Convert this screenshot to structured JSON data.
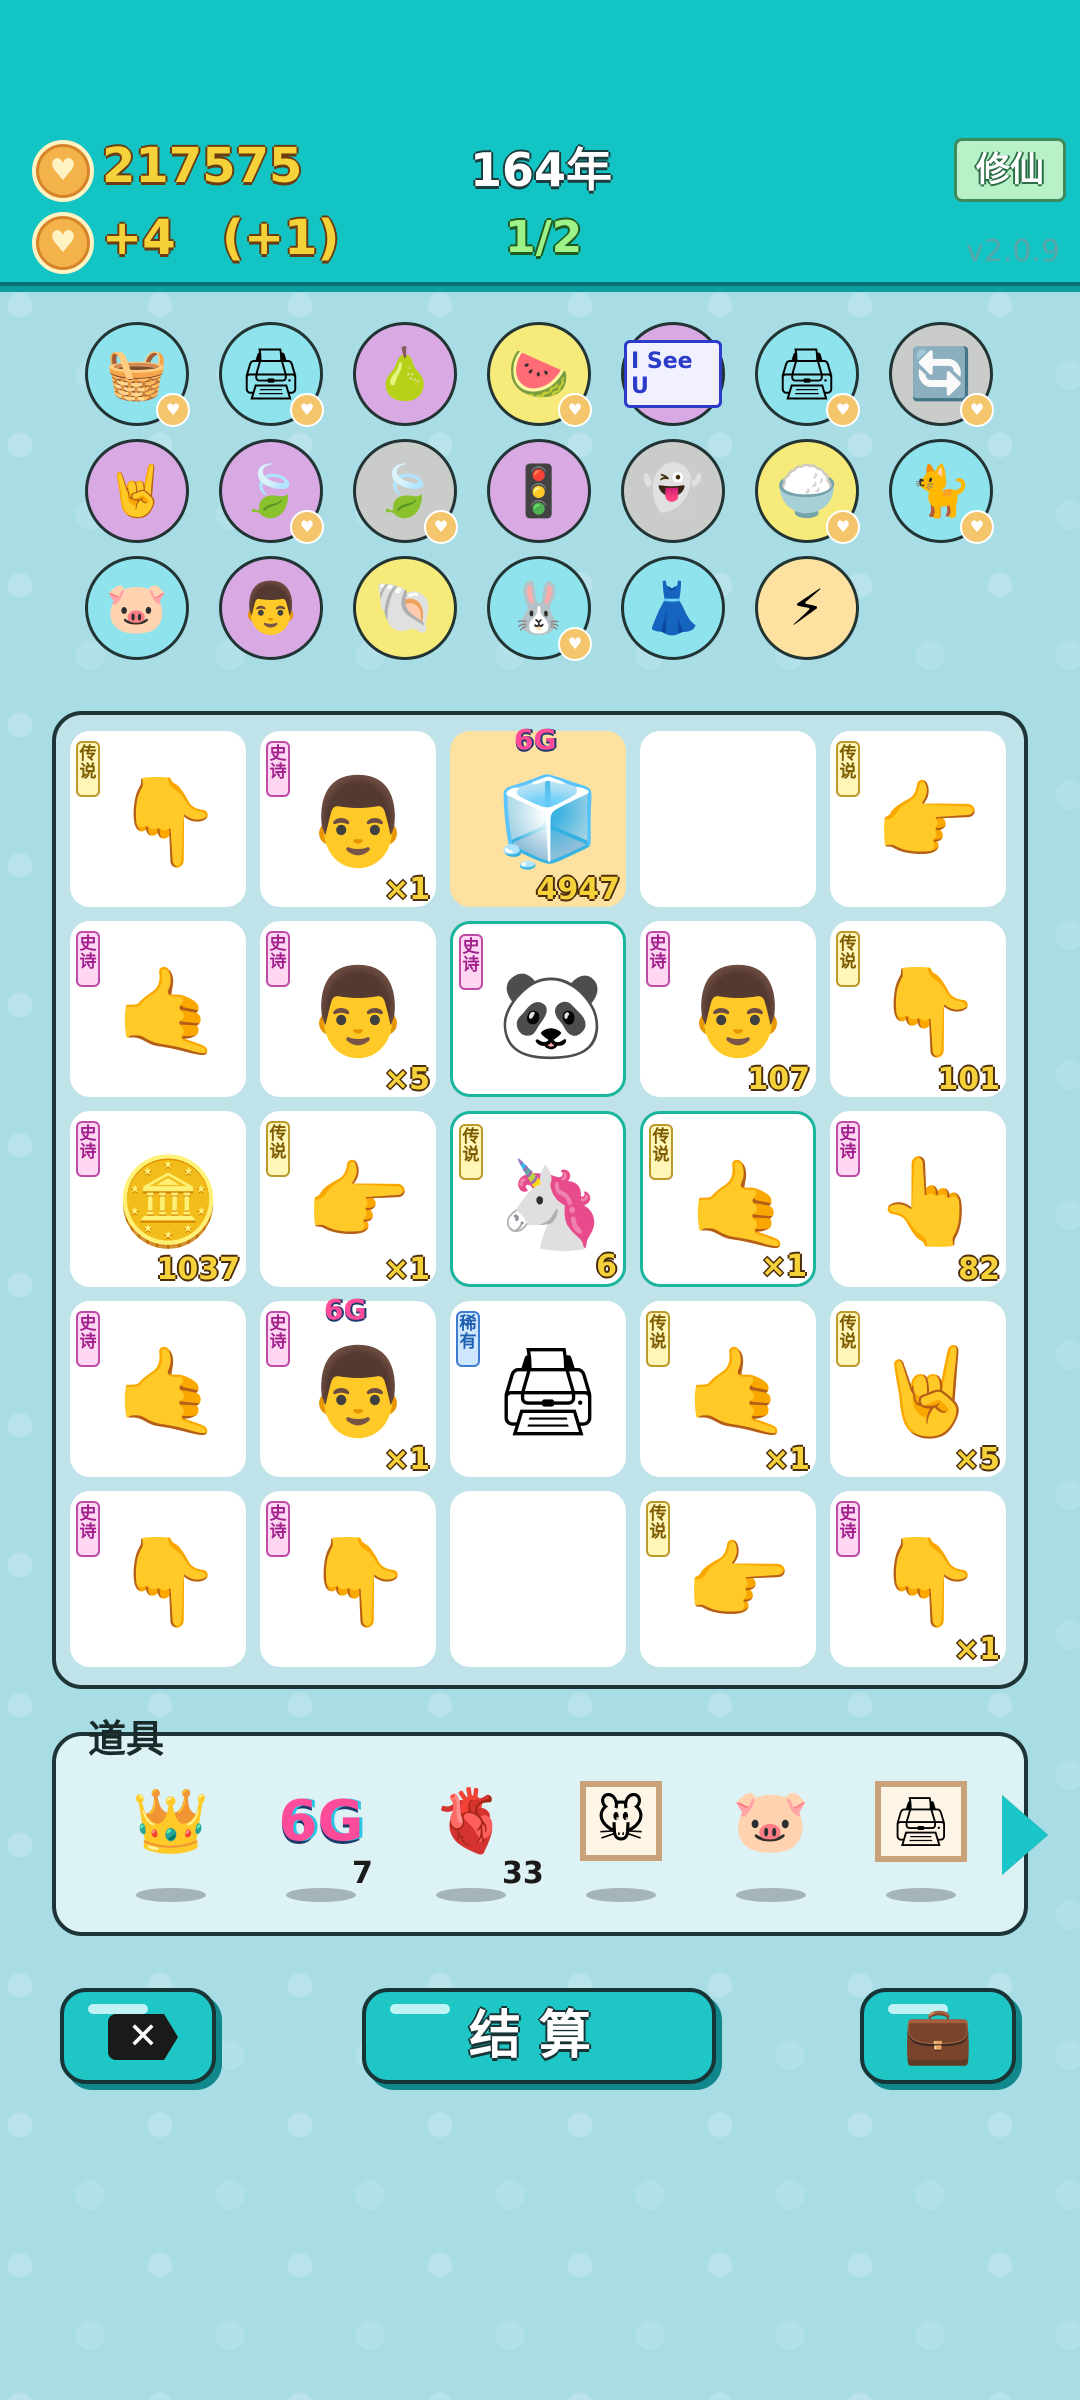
{
  "header": {
    "coins": "217575",
    "income": "+4",
    "bonus": "(+1)",
    "year": "164年",
    "round": "1/2",
    "mode_button": "修仙",
    "version": "v2.0.9"
  },
  "relics": [
    {
      "icon": "fruit-basket-icon",
      "glyph": "🧺",
      "bg": "#8fe3ec",
      "badge": true
    },
    {
      "icon": "printer-icon",
      "glyph": "🖨",
      "bg": "#8fe3ec",
      "badge": true
    },
    {
      "icon": "pomelo-icon",
      "glyph": "🍐",
      "bg": "#d8a9e3",
      "badge": false
    },
    {
      "icon": "fruit-plate-icon",
      "glyph": "🍉",
      "bg": "#f5ea7a",
      "badge": true
    },
    {
      "icon": "i-see-u-icon",
      "glyph": "I See U",
      "bg": "#d8a9e3",
      "badge": false
    },
    {
      "icon": "printer-icon",
      "glyph": "🖨",
      "bg": "#8fe3ec",
      "badge": true
    },
    {
      "icon": "refresh-icon",
      "glyph": "🔄",
      "bg": "#c9ccc9",
      "badge": true
    },
    {
      "icon": "rock-hand-icon",
      "glyph": "🤘",
      "bg": "#d8a9e3",
      "badge": false
    },
    {
      "icon": "leaf-icon",
      "glyph": "🍃",
      "bg": "#d8a9e3",
      "badge": true
    },
    {
      "icon": "leaf-icon",
      "glyph": "🍃",
      "bg": "#c9ccc9",
      "badge": true
    },
    {
      "icon": "traffic-light-ghost-icon",
      "glyph": "🚦",
      "bg": "#d8a9e3",
      "badge": false
    },
    {
      "icon": "ghost-icon",
      "glyph": "👻",
      "bg": "#c9ccc9",
      "badge": false
    },
    {
      "icon": "rice-bowl-icon",
      "glyph": "🍚",
      "bg": "#f5ea7a",
      "badge": true
    },
    {
      "icon": "cat-icon",
      "glyph": "🐈",
      "bg": "#8fe3ec",
      "badge": true
    },
    {
      "icon": "piggy-bank-icon",
      "glyph": "🐷",
      "bg": "#8fe3ec",
      "badge": false
    },
    {
      "icon": "multiplier-man-icon",
      "glyph": "👨",
      "bg": "#d8a9e3",
      "badge": false
    },
    {
      "icon": "shell-icon",
      "glyph": "🐚",
      "bg": "#f5ea7a",
      "badge": false
    },
    {
      "icon": "rabbit-icon",
      "glyph": "🐰",
      "bg": "#8fe3ec",
      "badge": true
    },
    {
      "icon": "skirt-icon",
      "glyph": "👗",
      "bg": "#8fe3ec",
      "badge": false
    },
    {
      "icon": "lightning-icon",
      "glyph": "⚡",
      "bg": "#fde1a0",
      "badge": false
    }
  ],
  "board": [
    [
      {
        "name": "legend-hand-cell",
        "tag": "传说",
        "tagType": "leg",
        "glyph": "👇",
        "count": ""
      },
      {
        "name": "epic-man-cell",
        "tag": "史诗",
        "tagType": "epic",
        "glyph": "👨",
        "count": "×1"
      },
      {
        "name": "fridge-cell",
        "tag": "",
        "tagType": "",
        "glyph": "🧊",
        "count": "4947",
        "gold": true,
        "top": "6G"
      },
      {
        "name": "empty-cell",
        "tag": "",
        "tagType": "",
        "glyph": "",
        "count": ""
      },
      {
        "name": "legend-hand-cell",
        "tag": "传说",
        "tagType": "leg",
        "glyph": "👉",
        "count": ""
      }
    ],
    [
      {
        "name": "epic-hand-cell",
        "tag": "史诗",
        "tagType": "epic",
        "glyph": "🤙",
        "count": ""
      },
      {
        "name": "epic-man-cell",
        "tag": "史诗",
        "tagType": "epic",
        "glyph": "👨",
        "count": "×5"
      },
      {
        "name": "panda-cell",
        "tag": "史诗",
        "tagType": "epic",
        "glyph": "🐼",
        "count": "",
        "hl": true
      },
      {
        "name": "epic-man-cell",
        "tag": "史诗",
        "tagType": "epic",
        "glyph": "👨",
        "count": "107"
      },
      {
        "name": "legend-hand-cell",
        "tag": "传说",
        "tagType": "leg",
        "glyph": "👇",
        "count": "101"
      }
    ],
    [
      {
        "name": "epic-coin-man-cell",
        "tag": "史诗",
        "tagType": "epic",
        "glyph": "🪙",
        "count": "1037"
      },
      {
        "name": "legend-hand-cell",
        "tag": "传说",
        "tagType": "leg",
        "glyph": "👉",
        "count": "×1"
      },
      {
        "name": "unicorn-cell",
        "tag": "传说",
        "tagType": "leg",
        "glyph": "🦄",
        "count": "6",
        "hl": true
      },
      {
        "name": "legend-hand-cell",
        "tag": "传说",
        "tagType": "leg",
        "glyph": "🤙",
        "count": "×1",
        "hl": true
      },
      {
        "name": "epic-hand-cell",
        "tag": "史诗",
        "tagType": "epic",
        "glyph": "👆",
        "count": "82"
      }
    ],
    [
      {
        "name": "epic-hand-cell",
        "tag": "史诗",
        "tagType": "epic",
        "glyph": "🤙",
        "count": ""
      },
      {
        "name": "epic-man-cell",
        "tag": "史诗",
        "tagType": "epic",
        "glyph": "👨",
        "count": "×1",
        "top": "6G"
      },
      {
        "name": "printer-cell",
        "tag": "稀有",
        "tagType": "rare",
        "glyph": "🖨",
        "count": ""
      },
      {
        "name": "legend-hand-cell",
        "tag": "传说",
        "tagType": "leg",
        "glyph": "🤙",
        "count": "×1"
      },
      {
        "name": "legend-hand-cell",
        "tag": "传说",
        "tagType": "leg",
        "glyph": "🤘",
        "count": "×5"
      }
    ],
    [
      {
        "name": "epic-hand-cell",
        "tag": "史诗",
        "tagType": "epic",
        "glyph": "👇",
        "count": ""
      },
      {
        "name": "epic-hand-cell",
        "tag": "史诗",
        "tagType": "epic",
        "glyph": "👇",
        "count": ""
      },
      {
        "name": "empty-cell",
        "tag": "",
        "tagType": "",
        "glyph": "",
        "count": ""
      },
      {
        "name": "legend-hand-cell",
        "tag": "传说",
        "tagType": "leg",
        "glyph": "👉",
        "count": ""
      },
      {
        "name": "epic-hand-cell",
        "tag": "史诗",
        "tagType": "epic",
        "glyph": "👇",
        "count": "×1"
      }
    ]
  ],
  "props": {
    "label": "道具",
    "items": [
      {
        "name": "crown-item",
        "glyph": "👑",
        "count": ""
      },
      {
        "name": "sixg-item",
        "glyph": "6G",
        "count": "7"
      },
      {
        "name": "liver-item",
        "glyph": "🫀",
        "count": "33"
      },
      {
        "name": "mouse-frame-item",
        "glyph": "🐭",
        "count": ""
      },
      {
        "name": "piggy-bank-item",
        "glyph": "🐷",
        "count": ""
      },
      {
        "name": "printer-frame-item",
        "glyph": "🖨",
        "count": ""
      }
    ]
  },
  "buttons": {
    "exit_icon": "✕",
    "settle": "结算",
    "bag_icon": "💼"
  }
}
